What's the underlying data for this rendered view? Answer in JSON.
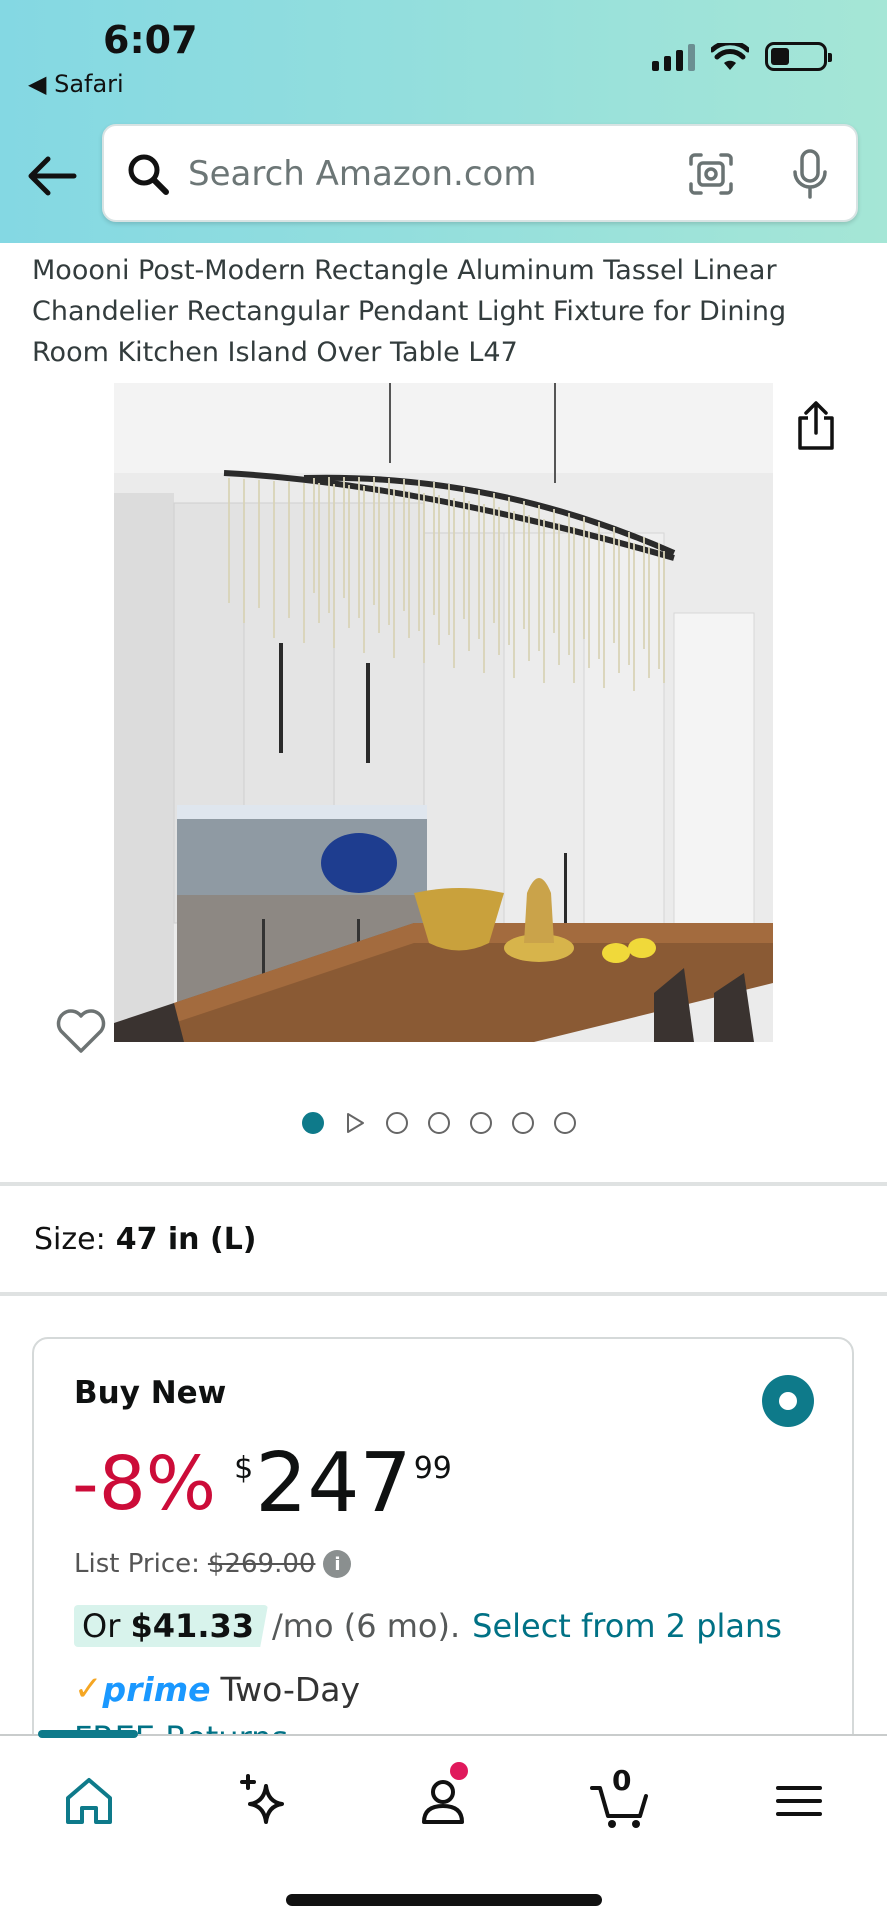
{
  "status_bar": {
    "time": "6:07",
    "back_app": "◀ Safari"
  },
  "search": {
    "placeholder": "Search Amazon.com"
  },
  "product": {
    "title": "Moooni Post-Modern Rectangle Aluminum Tassel Linear Chandelier Rectangular Pendant Light Fixture for Dining Room Kitchen Island Over Table L47",
    "image_count": 7,
    "active_image": 1
  },
  "size": {
    "label": "Size:",
    "value": "47 in (L)"
  },
  "buy_box": {
    "heading": "Buy New",
    "discount": "-8%",
    "currency": "$",
    "price_whole": "247",
    "price_fraction": "99",
    "list_price_label": "List Price:",
    "list_price": "$269.00",
    "installment_prefix": "Or",
    "installment_amount": "$41.33",
    "installment_term": "/mo (6 mo).",
    "plans_link": "Select from 2 plans",
    "prime_label": "prime",
    "delivery": "Two-Day",
    "returns": "FREE Returns"
  },
  "bottom_nav": {
    "items": [
      "home-icon",
      "sparkle-icon",
      "account-icon",
      "cart-icon",
      "menu-icon"
    ],
    "cart_count": "0",
    "active": "home"
  },
  "colors": {
    "header_gradient_start": "#84d8e3",
    "header_gradient_end": "#a5e6d6",
    "accent_teal": "#0e7a8a",
    "discount_red": "#cc0c39",
    "link": "#007185",
    "prime_blue": "#1a98ff"
  }
}
